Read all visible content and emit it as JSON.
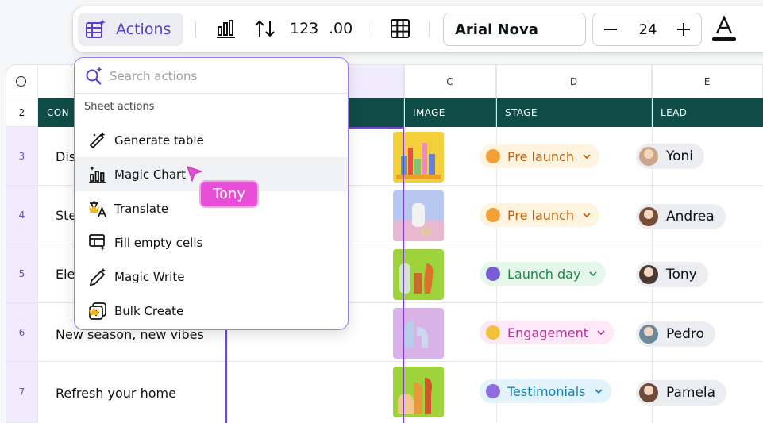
{
  "toolbar": {
    "actions_label": "Actions",
    "number_format_label": "123",
    "decimal_label": ".00",
    "font_name": "Arial Nova",
    "font_size": "24"
  },
  "sheet": {
    "columns": [
      "C",
      "D",
      "E"
    ],
    "headers": {
      "con": "CON",
      "image": "IMAGE",
      "stage": "STAGE",
      "lead": "LEAD"
    },
    "rows": [
      {
        "num": "3",
        "title": "Dis",
        "stage": "Pre launch",
        "stage_color": "#c45d0a",
        "stage_bg": "#fff4e0",
        "lead": "Yoni"
      },
      {
        "num": "4",
        "title": "Ste",
        "stage": "Pre launch",
        "stage_color": "#c45d0a",
        "stage_bg": "#fff4e0",
        "lead": "Andrea"
      },
      {
        "num": "5",
        "title": "Ele",
        "stage": "Launch day",
        "stage_color": "#1a8a45",
        "stage_bg": "#e5f7ea",
        "lead": "Tony"
      },
      {
        "num": "6",
        "title": "New season, new vibes",
        "stage": "Engagement",
        "stage_color": "#b5329e",
        "stage_bg": "#fce8f6",
        "lead": "Pedro"
      },
      {
        "num": "7",
        "title": "Refresh your home",
        "stage": "Testimonials",
        "stage_color": "#1a7fb0",
        "stage_bg": "#e3f3fb",
        "lead": "Pamela"
      }
    ],
    "row2_num": "2"
  },
  "dropdown": {
    "search_placeholder": "Search actions",
    "section_title": "Sheet actions",
    "items": [
      {
        "label": "Generate table",
        "icon": "magic-wand-icon",
        "premium": false
      },
      {
        "label": "Magic Chart",
        "icon": "magic-chart-icon",
        "premium": false
      },
      {
        "label": "Translate",
        "icon": "translate-icon",
        "premium": true
      },
      {
        "label": "Fill empty cells",
        "icon": "fill-cells-icon",
        "premium": false
      },
      {
        "label": "Magic Write",
        "icon": "magic-write-icon",
        "premium": false
      },
      {
        "label": "Bulk Create",
        "icon": "bulk-create-icon",
        "premium": true
      }
    ]
  },
  "collaborator": {
    "name": "Tony",
    "color": "#e64fd6"
  }
}
